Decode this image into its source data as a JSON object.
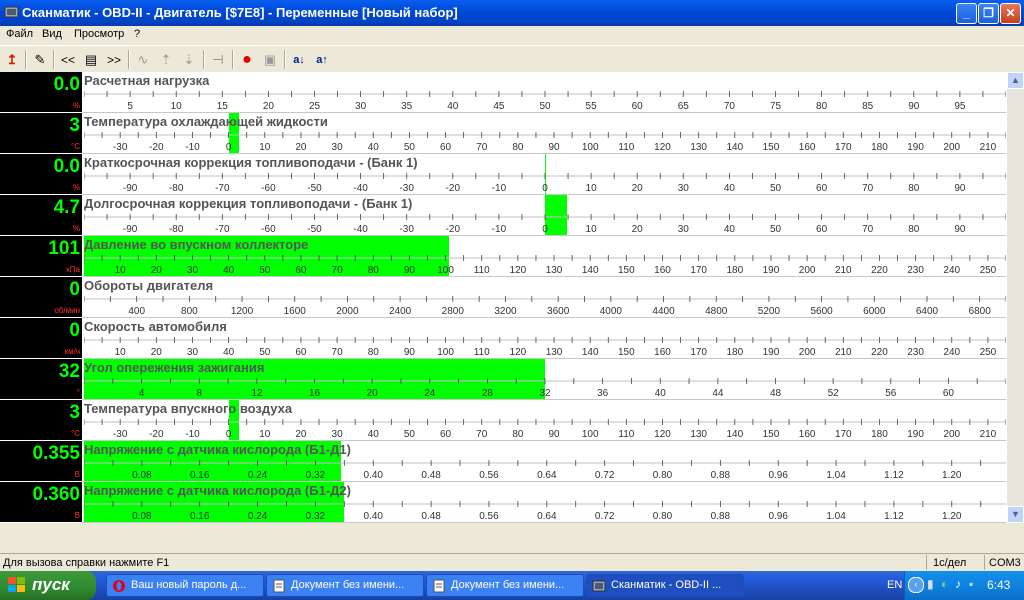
{
  "window": {
    "title": "Сканматик - OBD-II - Двигатель [$7E8] - Переменные [Новый набор]",
    "min_glyph": "_",
    "max_glyph": "❐",
    "close_glyph": "✕"
  },
  "menu": [
    "Файл",
    "Вид",
    "Просмотр",
    "?"
  ],
  "toolbar": {
    "icons": [
      "exit-icon",
      "edit-icon",
      "prev-icon",
      "list-icon",
      "next-icon",
      "wave-icon",
      "upload-icon",
      "download-icon",
      "connect-icon",
      "record-icon",
      "save-icon",
      "sort-desc-icon",
      "sort-asc-icon"
    ],
    "glyphs": [
      "↥",
      "✎",
      "<<",
      "▤",
      ">>",
      "∿",
      "⇡",
      "⇣",
      "⊣",
      "●",
      "▣",
      "a↓",
      "a↑"
    ]
  },
  "colors": {
    "bar": "#00ff00",
    "value": "#00ff00",
    "unit": "#ff3030",
    "record": "#e00000"
  },
  "rows": [
    {
      "name": "Расчетная нагрузка",
      "value": "0.0",
      "unit": "%",
      "min": 0,
      "max": 100,
      "bar_from": 0,
      "bar_to": 0,
      "ticks": [
        "5",
        "10",
        "15",
        "20",
        "25",
        "30",
        "35",
        "40",
        "45",
        "50",
        "55",
        "60",
        "65",
        "70",
        "75",
        "80",
        "85",
        "90",
        "95"
      ],
      "tick_start": 5,
      "tick_step": 5
    },
    {
      "name": "Температура охлаждающей жидкости",
      "value": "3",
      "unit": "°C",
      "min": -40,
      "max": 215,
      "bar_from": 0,
      "bar_to": 3,
      "ticks": [
        "-30",
        "-20",
        "-10",
        "0",
        "10",
        "20",
        "30",
        "40",
        "50",
        "60",
        "70",
        "80",
        "90",
        "100",
        "110",
        "120",
        "130",
        "140",
        "150",
        "160",
        "170",
        "180",
        "190",
        "200",
        "210"
      ],
      "tick_start": -30,
      "tick_step": 10
    },
    {
      "name": "Краткосрочная коррекция топливоподачи - (Банк 1)",
      "value": "0.0",
      "unit": "%",
      "min": -100,
      "max": 100,
      "bar_from": 0,
      "bar_to": 0,
      "ticks": [
        "-90",
        "-80",
        "-70",
        "-60",
        "-50",
        "-40",
        "-30",
        "-20",
        "-10",
        "0",
        "10",
        "20",
        "30",
        "40",
        "50",
        "60",
        "70",
        "80",
        "90"
      ],
      "tick_start": -90,
      "tick_step": 10
    },
    {
      "name": "Долгосрочная коррекция топливоподачи -  (Банк 1)",
      "value": "4.7",
      "unit": "%",
      "min": -100,
      "max": 100,
      "bar_from": 0,
      "bar_to": 4.7,
      "ticks": [
        "-90",
        "-80",
        "-70",
        "-60",
        "-50",
        "-40",
        "-30",
        "-20",
        "-10",
        "0",
        "10",
        "20",
        "30",
        "40",
        "50",
        "60",
        "70",
        "80",
        "90"
      ],
      "tick_start": -90,
      "tick_step": 10
    },
    {
      "name": "Давление во впускном коллекторе",
      "value": "101",
      "unit": "кПа",
      "min": 0,
      "max": 255,
      "bar_from": 0,
      "bar_to": 101,
      "ticks": [
        "10",
        "20",
        "30",
        "40",
        "50",
        "60",
        "70",
        "80",
        "90",
        "100",
        "110",
        "120",
        "130",
        "140",
        "150",
        "160",
        "170",
        "180",
        "190",
        "200",
        "210",
        "220",
        "230",
        "240",
        "250"
      ],
      "tick_start": 10,
      "tick_step": 10
    },
    {
      "name": "Обороты двигателя",
      "value": "0",
      "unit": "об/мин",
      "min": 0,
      "max": 7000,
      "bar_from": 0,
      "bar_to": 0,
      "ticks": [
        "400",
        "800",
        "1200",
        "1600",
        "2000",
        "2400",
        "2800",
        "3200",
        "3600",
        "4000",
        "4400",
        "4800",
        "5200",
        "5600",
        "6000",
        "6400",
        "6800"
      ],
      "tick_start": 400,
      "tick_step": 400
    },
    {
      "name": "Скорость автомобиля",
      "value": "0",
      "unit": "км/ч",
      "min": 0,
      "max": 255,
      "bar_from": 0,
      "bar_to": 0,
      "ticks": [
        "10",
        "20",
        "30",
        "40",
        "50",
        "60",
        "70",
        "80",
        "90",
        "100",
        "110",
        "120",
        "130",
        "140",
        "150",
        "160",
        "170",
        "180",
        "190",
        "200",
        "210",
        "220",
        "230",
        "240",
        "250"
      ],
      "tick_start": 10,
      "tick_step": 10
    },
    {
      "name": "Угол опережения зажигания",
      "value": "32",
      "unit": "°",
      "min": 0,
      "max": 64,
      "bar_from": 0,
      "bar_to": 32,
      "ticks": [
        "4",
        "8",
        "12",
        "16",
        "20",
        "24",
        "28",
        "32",
        "36",
        "40",
        "44",
        "48",
        "52",
        "56",
        "60"
      ],
      "tick_start": 4,
      "tick_step": 4
    },
    {
      "name": "Температура впускного воздуха",
      "value": "3",
      "unit": "°C",
      "min": -40,
      "max": 215,
      "bar_from": 0,
      "bar_to": 3,
      "ticks": [
        "-30",
        "-20",
        "-10",
        "0",
        "10",
        "20",
        "30",
        "40",
        "50",
        "60",
        "70",
        "80",
        "90",
        "100",
        "110",
        "120",
        "130",
        "140",
        "150",
        "160",
        "170",
        "180",
        "190",
        "200",
        "210"
      ],
      "tick_start": -30,
      "tick_step": 10
    },
    {
      "name": "Напряжение с датчика кислорода (Б1-Д1)",
      "value": "0.355",
      "unit": "В",
      "min": 0,
      "max": 1.275,
      "bar_from": 0,
      "bar_to": 0.355,
      "ticks": [
        "0.08",
        "0.16",
        "0.24",
        "0.32",
        "0.40",
        "0.48",
        "0.56",
        "0.64",
        "0.72",
        "0.80",
        "0.88",
        "0.96",
        "1.04",
        "1.12",
        "1.20"
      ],
      "tick_start": 0.08,
      "tick_step": 0.08
    },
    {
      "name": "Напряжение с датчика кислорода (Б1-Д2)",
      "value": "0.360",
      "unit": "В",
      "min": 0,
      "max": 1.275,
      "bar_from": 0,
      "bar_to": 0.36,
      "ticks": [
        "0.08",
        "0.16",
        "0.24",
        "0.32",
        "0.40",
        "0.48",
        "0.56",
        "0.64",
        "0.72",
        "0.80",
        "0.88",
        "0.96",
        "1.04",
        "1.12",
        "1.20"
      ],
      "tick_start": 0.08,
      "tick_step": 0.08
    }
  ],
  "status": {
    "help": "Для вызова справки нажмите F1",
    "rate": "1с/дел",
    "port": "COM3"
  },
  "taskbar": {
    "start": "пуск",
    "tasks": [
      {
        "label": "Ваш новый пароль д...",
        "icon": "opera-icon"
      },
      {
        "label": "Документ без имени...",
        "icon": "document-icon"
      },
      {
        "label": "Документ без имени...",
        "icon": "document-icon"
      },
      {
        "label": "Сканматик - OBD-II ...",
        "icon": "scanmatik-icon"
      }
    ],
    "lang": "EN",
    "clock": "6:43"
  }
}
